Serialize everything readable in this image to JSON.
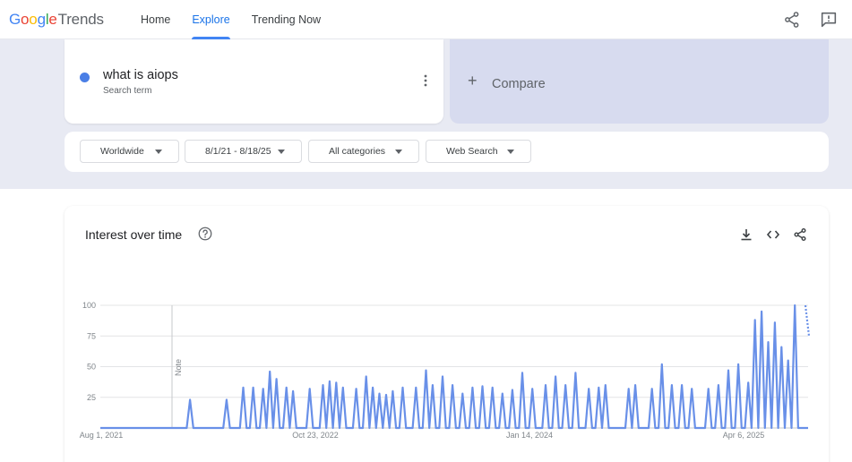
{
  "header": {
    "logo": {
      "g": "G",
      "o1": "o",
      "o2": "o",
      "g2": "g",
      "l": "l",
      "e": "e",
      "trends": "Trends"
    },
    "nav": [
      {
        "label": "Home",
        "active": false
      },
      {
        "label": "Explore",
        "active": true
      },
      {
        "label": "Trending Now",
        "active": false
      }
    ],
    "icons": [
      "share-icon",
      "feedback-icon"
    ]
  },
  "search_term": {
    "term": "what is aiops",
    "subtitle": "Search term",
    "color": "#4a7fe6"
  },
  "compare": {
    "label": "Compare"
  },
  "filters": [
    {
      "label": "Worldwide"
    },
    {
      "label": "8/1/21 - 8/18/25"
    },
    {
      "label": "All categories"
    },
    {
      "label": "Web Search"
    }
  ],
  "chart_card": {
    "title": "Interest over time",
    "icons": [
      "help-icon",
      "download-icon",
      "embed-icon",
      "share-icon"
    ]
  },
  "chart_data": {
    "type": "line",
    "y_ticks": [
      "100",
      "75",
      "50",
      "25"
    ],
    "x_tick_labels": [
      "Aug 1, 2021",
      "Oct 23, 2022",
      "Jan 14, 2024",
      "Apr 6, 2025"
    ],
    "annotation": "Note",
    "ylim": [
      0,
      100
    ],
    "grid": true,
    "series_color": "#6990e8",
    "series": [
      {
        "values": [
          0,
          0,
          0,
          0,
          0,
          0,
          0,
          0,
          0,
          0,
          0,
          0,
          0,
          0,
          0,
          0,
          0,
          0,
          0,
          0,
          0,
          0,
          0,
          0,
          0,
          0,
          0,
          0,
          0,
          0,
          0,
          0,
          0,
          0,
          0,
          0,
          0,
          0,
          0,
          0,
          0,
          0,
          0,
          0,
          0,
          0,
          0,
          0,
          0,
          0,
          0,
          0,
          0,
          0,
          0,
          0,
          0,
          0,
          0,
          0,
          0,
          0,
          0,
          0,
          0,
          0,
          0,
          0,
          0,
          0,
          0,
          0,
          0,
          0,
          0,
          0,
          0,
          0,
          0,
          0,
          0,
          0,
          0,
          0,
          0,
          0,
          0,
          0,
          0,
          0,
          0,
          0,
          0,
          0,
          0,
          0,
          0,
          0,
          0,
          0,
          0,
          0,
          0,
          0,
          0,
          0,
          0,
          0,
          0,
          0,
          0,
          0,
          0,
          0,
          0,
          0,
          0,
          0,
          0,
          0,
          0,
          0,
          0,
          0,
          0,
          0,
          0,
          0,
          0,
          0,
          0,
          0,
          0,
          0,
          0,
          0,
          0,
          0,
          0,
          0,
          0,
          0,
          0,
          0,
          0,
          0,
          0,
          0,
          0,
          0,
          0,
          0,
          0,
          0,
          0,
          0,
          0,
          0,
          0,
          0,
          0,
          0,
          0,
          0,
          0,
          0,
          0,
          0,
          0,
          0,
          0,
          0,
          0,
          0,
          0,
          0,
          0,
          0,
          0,
          0,
          0,
          0,
          0,
          0,
          0,
          0,
          0,
          0,
          0,
          0,
          0,
          0,
          0,
          0,
          0,
          0,
          0,
          0,
          0,
          0,
          0,
          0,
          0,
          0,
          0,
          0,
          0,
          0,
          0,
          0,
          0,
          0,
          0,
          0
        ]
      }
    ],
    "peaks": [
      [
        27,
        23
      ],
      [
        38,
        23
      ],
      [
        43,
        33
      ],
      [
        46,
        33
      ],
      [
        49,
        32
      ],
      [
        51,
        46
      ],
      [
        53,
        40
      ],
      [
        56,
        33
      ],
      [
        58,
        30
      ],
      [
        63,
        32
      ],
      [
        67,
        35
      ],
      [
        69,
        38
      ],
      [
        71,
        37
      ],
      [
        73,
        33
      ],
      [
        77,
        32
      ],
      [
        80,
        42
      ],
      [
        82,
        33
      ],
      [
        84,
        28
      ],
      [
        86,
        27
      ],
      [
        88,
        30
      ],
      [
        91,
        33
      ],
      [
        95,
        33
      ],
      [
        98,
        47
      ],
      [
        100,
        35
      ],
      [
        103,
        42
      ],
      [
        106,
        35
      ],
      [
        109,
        28
      ],
      [
        112,
        33
      ],
      [
        115,
        34
      ],
      [
        118,
        33
      ],
      [
        121,
        28
      ],
      [
        124,
        31
      ],
      [
        127,
        45
      ],
      [
        130,
        32
      ],
      [
        134,
        35
      ],
      [
        137,
        42
      ],
      [
        140,
        35
      ],
      [
        143,
        45
      ],
      [
        147,
        32
      ],
      [
        150,
        33
      ],
      [
        152,
        35
      ],
      [
        159,
        32
      ],
      [
        161,
        35
      ],
      [
        166,
        32
      ],
      [
        169,
        52
      ],
      [
        172,
        35
      ],
      [
        175,
        35
      ],
      [
        178,
        32
      ],
      [
        183,
        32
      ],
      [
        186,
        35
      ],
      [
        189,
        47
      ],
      [
        192,
        52
      ],
      [
        195,
        37
      ],
      [
        197,
        88
      ],
      [
        199,
        95
      ],
      [
        201,
        70
      ],
      [
        203,
        86
      ],
      [
        205,
        66
      ],
      [
        207,
        55
      ],
      [
        209,
        100
      ]
    ]
  }
}
